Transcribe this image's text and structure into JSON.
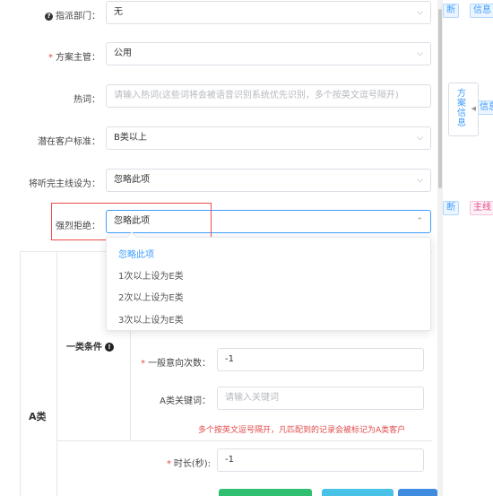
{
  "form": {
    "fields": [
      {
        "label": "指派部门：",
        "value": "无",
        "required": false,
        "help_icon": true
      },
      {
        "label": "方案主管：",
        "value": "公用",
        "required": true
      },
      {
        "label": "热词：",
        "placeholder": "请输入热词(这些词将会被语音识别系统优先识别，多个按英文逗号隔开)"
      },
      {
        "label": "潜在客户标准：",
        "value": "B类以上"
      },
      {
        "label": "将听完主线设为：",
        "value": "忽略此项"
      },
      {
        "label": "强烈拒绝：",
        "value": "忽略此项"
      }
    ],
    "dropdown_options": [
      "忽略此项",
      "1次以上设为E类",
      "2次以上设为E类",
      "3次以上设为E类"
    ],
    "selected_option_index": 0
  },
  "section": {
    "title": "A类",
    "subtitle": "一类条件",
    "fields": [
      {
        "label": "一般意向次数：",
        "value": "-1",
        "required": true
      },
      {
        "label": "A类关键词：",
        "placeholder": "请输入关键词"
      },
      {
        "label": "时长(秒):",
        "value": "-1",
        "required": true
      }
    ],
    "hint": "多个按英文逗号隔开，凡匹配到的记录会被标记为A类客户"
  },
  "side_tab": {
    "label": "方案信息"
  },
  "right_tags": [
    "断",
    "信息",
    "信息",
    "断",
    "主线"
  ],
  "colors": {
    "accent": "#409eff",
    "danger": "#e24b4b",
    "border": "#dcdfe6"
  }
}
